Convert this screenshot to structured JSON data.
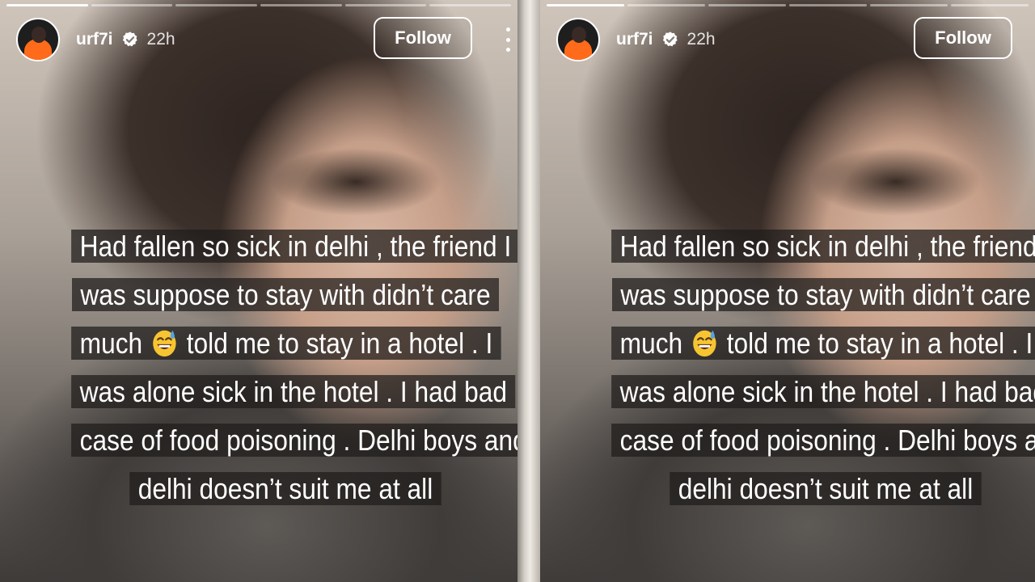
{
  "story": {
    "username": "urf7i",
    "time_ago": "22h",
    "follow_label": "Follow",
    "caption_lines": [
      "Had fallen so sick in delhi , the friend I",
      "was suppose to stay with didn’t care",
      "much",
      "told me to stay in a hotel . I",
      "was alone sick in the hotel . I had bad",
      "case of food poisoning . Delhi boys and",
      "delhi doesn’t suit me at all"
    ],
    "progress": {
      "segments": 6,
      "completed": 1
    }
  },
  "icons": {
    "verified": "verified-badge-icon",
    "more": "more-options-icon",
    "emoji": "grinning-face-with-sweat-emoji"
  },
  "colors": {
    "text": "#ffffff",
    "caption_background": "rgba(30,28,27,0.72)",
    "avatar_accent": "#ff6b1a"
  }
}
